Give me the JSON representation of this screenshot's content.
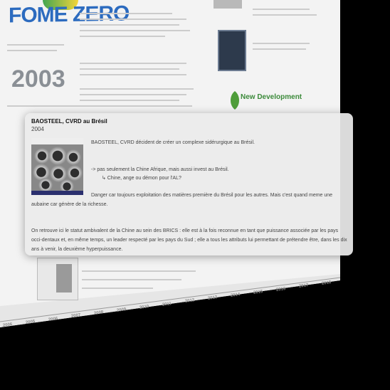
{
  "background": {
    "logo_text": "FOME ZERO",
    "year_big": "2003",
    "new_development_logo_text": "New Development",
    "timeline_labels": [
      "2006",
      "2005",
      "2006",
      "2007",
      "2008",
      "2009",
      "2010",
      "2011",
      "2012",
      "2013",
      "2014",
      "2015",
      "2016",
      "2017",
      "2018"
    ]
  },
  "popup": {
    "title": "BAOSTEEL, CVRD au Brésil",
    "year": "2004",
    "image_caption_icon": "steel-pipes-photo",
    "line1": "BAOSTEEL, CVRD décident de créer un complexe sidérurgique au Brésil.",
    "line2": "-> pas seulement la Chine Afrique, mais aussi invest au Brésil.",
    "line3": "↳ Chine, ange ou démon pour l'AL?",
    "line4": "Danger car toujours exploitation des matières première du Brésil pour les autres. Mais c'est quand meme une aubaine car génère de la richesse.",
    "line5": "On retrouve ici le statut ambivalent de la Chine au sein des BRICS : elle est à la fois reconnue en tant que puissance associée par les pays occi-dentaux et, en même temps, un leader respecté par les pays du Sud ; elle a tous les attributs lui permettant de prétendre être, dans les dix ans à venir, la deuxième hyperpuissance."
  }
}
